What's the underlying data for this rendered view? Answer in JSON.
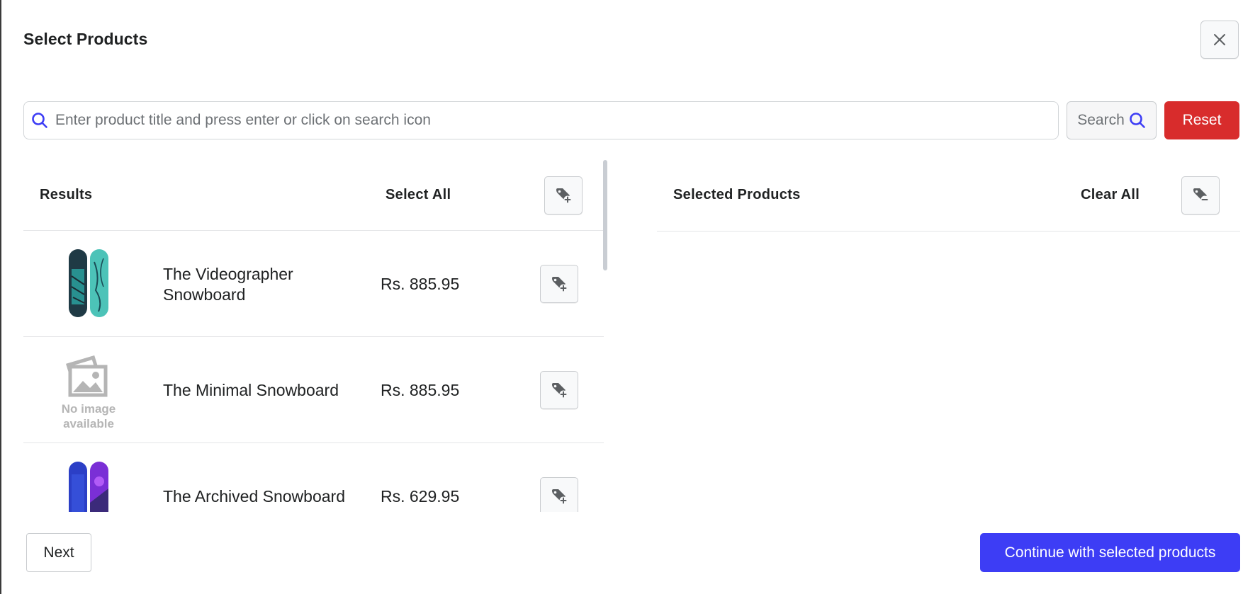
{
  "modal": {
    "title": "Select Products"
  },
  "search": {
    "placeholder": "Enter product title and press enter or click on search icon",
    "value": "",
    "search_button_label": "Search",
    "reset_button_label": "Reset"
  },
  "results": {
    "header_label": "Results",
    "select_all_label": "Select All",
    "items": [
      {
        "title_line1": "The Videographer",
        "title_line2": "Snowboard",
        "price": "Rs. 885.95",
        "image": "snowboard-teal-black"
      },
      {
        "title_line1": "The Minimal Snowboard",
        "title_line2": "",
        "price": "Rs. 885.95",
        "image": "no-image",
        "no_image_line1": "No image",
        "no_image_line2": "available"
      },
      {
        "title_line1": "The Archived Snowboard",
        "title_line2": "",
        "price": "Rs. 629.95",
        "image": "snowboard-blue-purple"
      }
    ]
  },
  "selected": {
    "header_label": "Selected Products",
    "clear_all_label": "Clear All"
  },
  "footer": {
    "next_label": "Next",
    "continue_label": "Continue with selected products"
  },
  "colors": {
    "primary": "#3d3df5",
    "danger": "#d82c2c",
    "search_icon": "#3d3df5"
  }
}
